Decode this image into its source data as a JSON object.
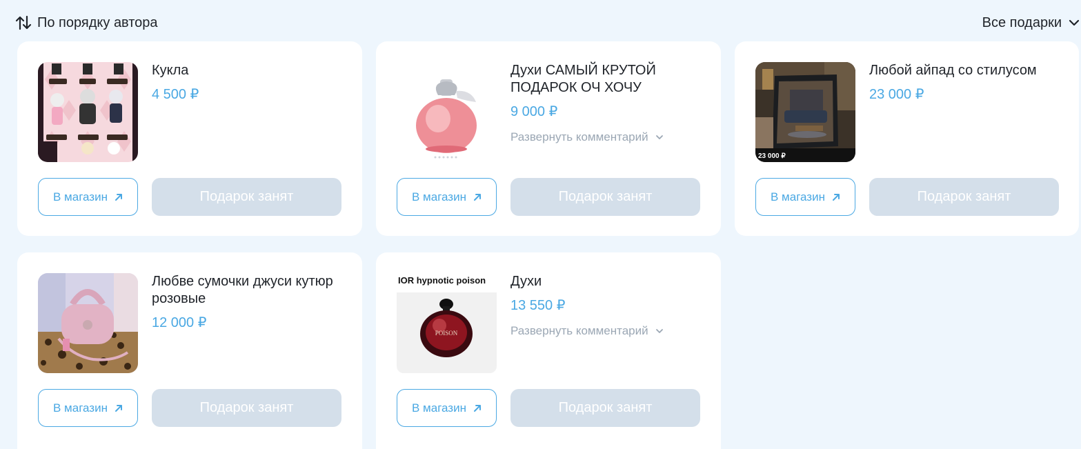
{
  "toolbar": {
    "sort_label": "По порядку автора",
    "filter_label": "Все подарки"
  },
  "colors": {
    "page_bg": "#eef6fd",
    "accent": "#4aa8e3",
    "taken_bg": "#d4dfea",
    "muted": "#9ba7b4"
  },
  "gifts": [
    {
      "title": "Кукла",
      "price": "4 500 ₽",
      "shop_label": "В магазин",
      "taken_label": "Подарок занят",
      "image": "doll-collage-image"
    },
    {
      "title": "Духи САМЫЙ КРУТОЙ ПОДАРОК ОЧ ХОЧУ",
      "price": "9 000 ₽",
      "comment_label": "Развернуть комментарий",
      "shop_label": "В магазин",
      "taken_label": "Подарок занят",
      "image": "apple-perfume-bottle-image"
    },
    {
      "title": "Любой айпад со стилусом",
      "price": "23 000 ₽",
      "image_caption": "23 000 ₽",
      "shop_label": "В магазин",
      "taken_label": "Подарок занят",
      "image": "ipad-photo-image"
    },
    {
      "title": "Любве сумочки джуси кутюр розовые",
      "price": "12 000 ₽",
      "shop_label": "В магазин",
      "taken_label": "Подарок занят",
      "image": "pink-bag-photo-image"
    },
    {
      "title": "Духи",
      "price": "13 550 ₽",
      "image_caption": "IOR hypnotic poison",
      "comment_label": "Развернуть комментарий",
      "shop_label": "В магазин",
      "taken_label": "Подарок занят",
      "image": "hypnotic-poison-bottle-image"
    }
  ]
}
